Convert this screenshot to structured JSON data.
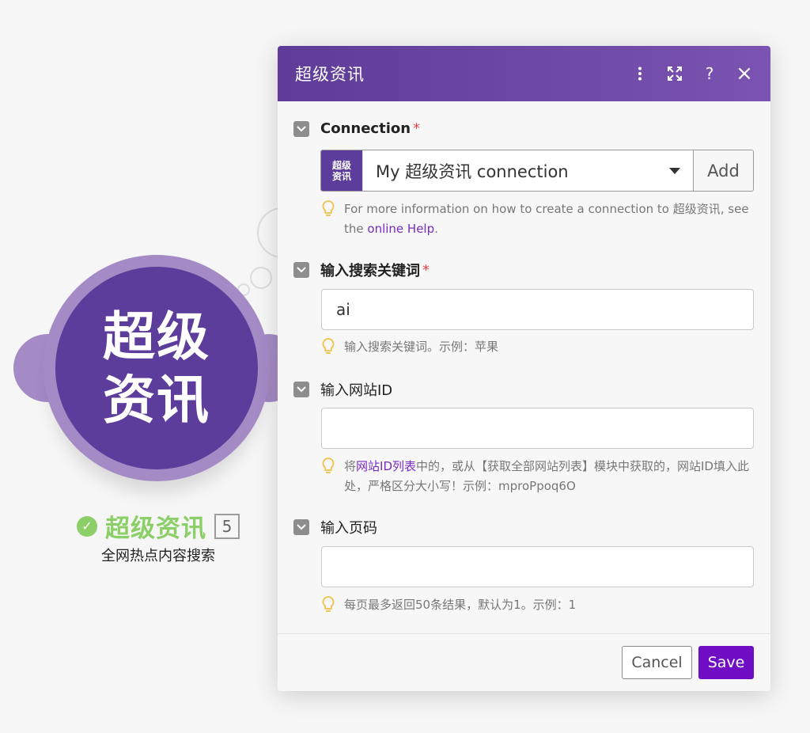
{
  "module": {
    "logo_line1": "超级",
    "logo_line2": "资讯",
    "name": "超级资讯",
    "badge": "5",
    "subtitle": "全网热点内容搜索",
    "status_color": "#8ccf68",
    "brand_color": "#5d3d9c"
  },
  "dialog": {
    "title": "超级资讯",
    "header_icons": [
      "more-vertical-icon",
      "expand-icon",
      "help-icon",
      "close-icon"
    ],
    "help_glyph": "?",
    "close_glyph": "×"
  },
  "connection": {
    "label": "Connection",
    "required_mark": "*",
    "logo_line1": "超级",
    "logo_line2": "资讯",
    "selected": "My 超级资讯 connection",
    "add_label": "Add",
    "hint_prefix": "For more information on how to create a connection to 超级资讯, see the ",
    "hint_link": "online Help",
    "hint_suffix": "."
  },
  "keyword": {
    "label": "输入搜索关键词",
    "required_mark": "*",
    "value": "ai",
    "hint": "输入搜索关键词。示例：苹果"
  },
  "site_id": {
    "label": "输入网站ID",
    "value": "",
    "hint_prefix": "将",
    "hint_link": "网站ID列表",
    "hint_suffix": "中的，或从【获取全部网站列表】模块中获取的，网站ID填入此处，严格区分大小写！示例：mproPpoq6O"
  },
  "page_num": {
    "label": "输入页码",
    "value": "",
    "hint": "每页最多返回50条结果，默认为1。示例：1"
  },
  "footer": {
    "cancel_label": "Cancel",
    "save_label": "Save",
    "save_color": "#6f0ec5"
  },
  "check_glyph": "✓"
}
